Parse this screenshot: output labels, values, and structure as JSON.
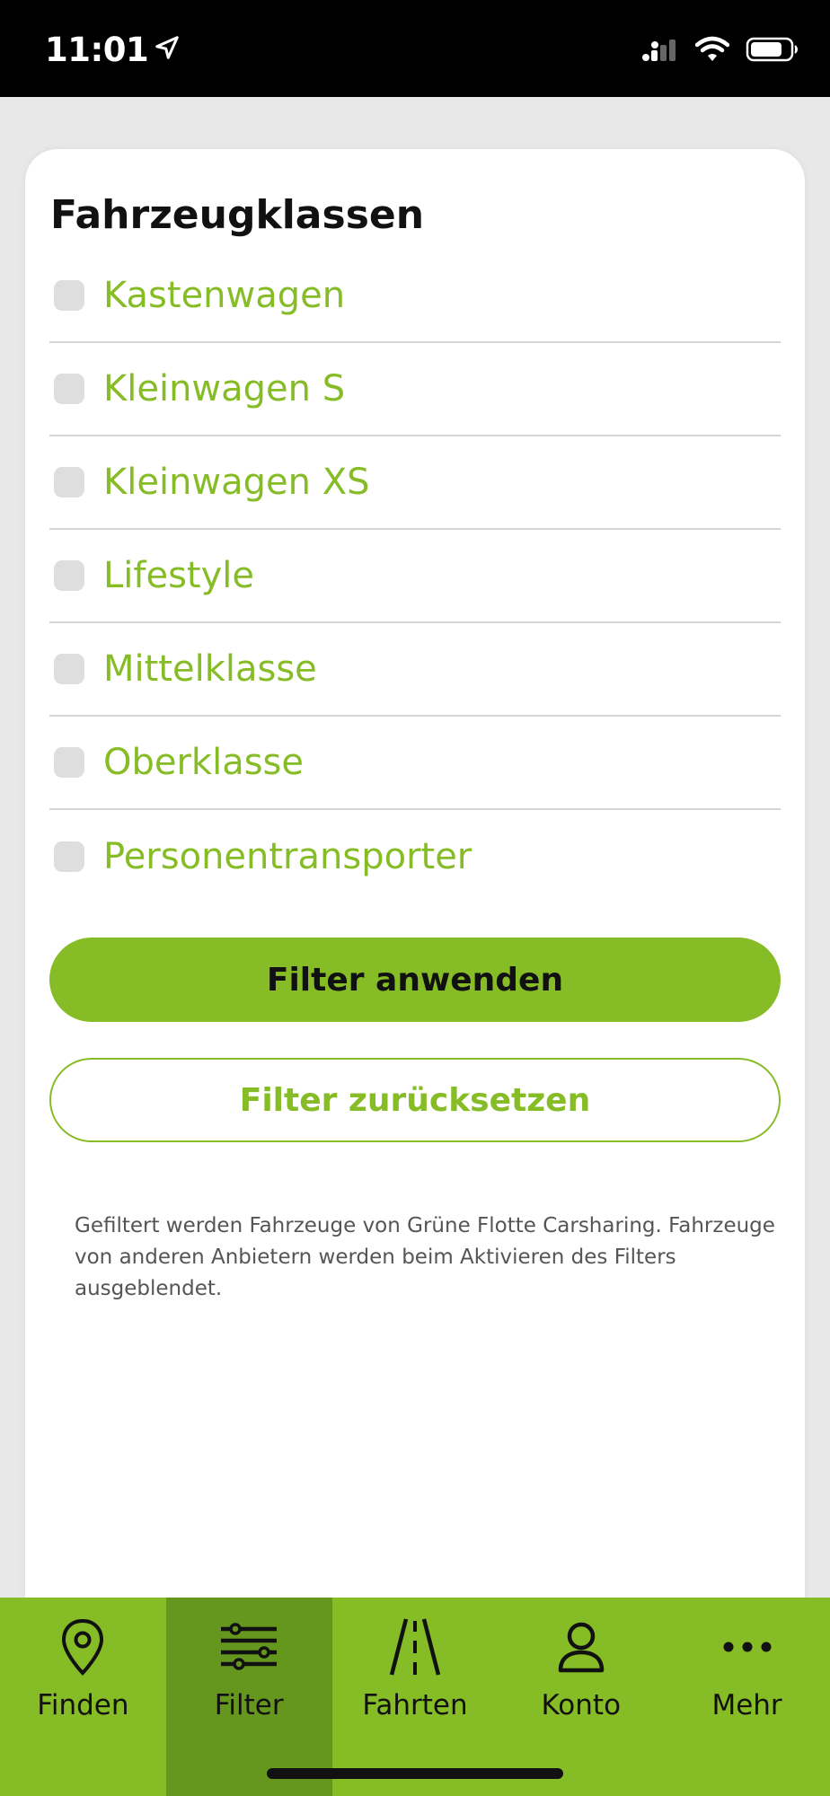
{
  "status_bar": {
    "time": "11:01",
    "icons": [
      "location-arrow-icon",
      "cellular-signal-icon",
      "wifi-icon",
      "battery-icon"
    ]
  },
  "sheet": {
    "title": "Fahrzeugklassen",
    "vehicle_classes": [
      {
        "label": "Kastenwagen",
        "checked": false
      },
      {
        "label": "Kleinwagen S",
        "checked": false
      },
      {
        "label": "Kleinwagen XS",
        "checked": false
      },
      {
        "label": "Lifestyle",
        "checked": false
      },
      {
        "label": "Mittelklasse",
        "checked": false
      },
      {
        "label": "Oberklasse",
        "checked": false
      },
      {
        "label": "Personentransporter",
        "checked": false
      }
    ],
    "apply_label": "Filter anwenden",
    "reset_label": "Filter zurücksetzen",
    "footnote": "Gefiltert werden Fahrzeuge von Grüne Flotte Carsharing. Fahrzeuge von anderen Anbietern werden beim Aktivieren des Filters ausgeblendet."
  },
  "tab_bar": {
    "tabs": [
      {
        "label": "Finden",
        "icon": "map-pin-icon",
        "active": false
      },
      {
        "label": "Filter",
        "icon": "sliders-icon",
        "active": true
      },
      {
        "label": "Fahrten",
        "icon": "road-icon",
        "active": false
      },
      {
        "label": "Konto",
        "icon": "user-icon",
        "active": false
      },
      {
        "label": "Mehr",
        "icon": "more-dots-icon",
        "active": false
      }
    ]
  },
  "colors": {
    "accent": "#86bc25",
    "accent_dark": "#65961e",
    "checkbox": "#dedede",
    "divider": "#d6d6d6"
  }
}
